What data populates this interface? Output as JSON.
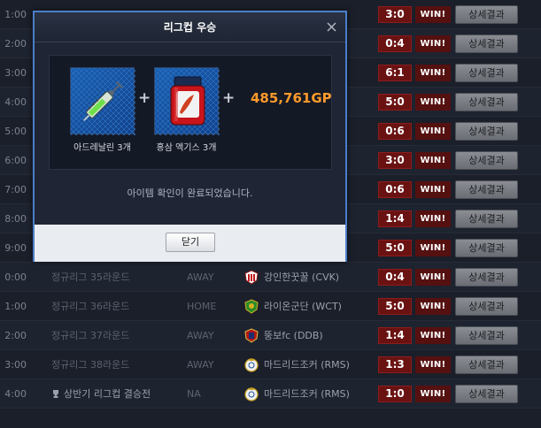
{
  "matches": [
    {
      "time": "1:00",
      "league": "",
      "venue": "",
      "team": "",
      "score": "3:0",
      "result": "WIN!",
      "detail": "상세결과"
    },
    {
      "time": "2:00",
      "league": "",
      "venue": "",
      "team": "",
      "score": "0:4",
      "result": "WIN!",
      "detail": "상세결과"
    },
    {
      "time": "3:00",
      "league": "",
      "venue": "",
      "team": "",
      "score": "6:1",
      "result": "WIN!",
      "detail": "상세결과"
    },
    {
      "time": "4:00",
      "league": "",
      "venue": "",
      "team": "",
      "score": "5:0",
      "result": "WIN!",
      "detail": "상세결과"
    },
    {
      "time": "5:00",
      "league": "",
      "venue": "",
      "team": "",
      "score": "0:6",
      "result": "WIN!",
      "detail": "상세결과"
    },
    {
      "time": "6:00",
      "league": "",
      "venue": "",
      "team": "",
      "score": "3:0",
      "result": "WIN!",
      "detail": "상세결과"
    },
    {
      "time": "7:00",
      "league": "",
      "venue": "",
      "team": "",
      "score": "0:6",
      "result": "WIN!",
      "detail": "상세결과"
    },
    {
      "time": "8:00",
      "league": "",
      "venue": "",
      "team": "",
      "score": "1:4",
      "result": "WIN!",
      "detail": "상세결과"
    },
    {
      "time": "9:00",
      "league": "",
      "venue": "",
      "team": "",
      "score": "5:0",
      "result": "WIN!",
      "detail": "상세결과"
    },
    {
      "time": "0:00",
      "league": "정규리그 35라운드",
      "venue": "AWAY",
      "team": "강인한꿋꿀 (CVK)",
      "score": "0:4",
      "result": "WIN!",
      "detail": "상세결과"
    },
    {
      "time": "1:00",
      "league": "정규리그 36라운드",
      "venue": "HOME",
      "team": "라이온군단 (WCT)",
      "score": "5:0",
      "result": "WIN!",
      "detail": "상세결과"
    },
    {
      "time": "2:00",
      "league": "정규리그 37라운드",
      "venue": "AWAY",
      "team": "뚱보fc (DDB)",
      "score": "1:4",
      "result": "WIN!",
      "detail": "상세결과"
    },
    {
      "time": "3:00",
      "league": "정규리그 38라운드",
      "venue": "AWAY",
      "team": "마드리드조커 (RMS)",
      "score": "1:3",
      "result": "WIN!",
      "detail": "상세결과"
    },
    {
      "time": "4:00",
      "league": "상반기 리그컵 결승전",
      "venue": "NA",
      "team": "마드리드조커 (RMS)",
      "score": "1:0",
      "result": "WIN!",
      "detail": "상세결과"
    }
  ],
  "modal": {
    "title": "리그컵 우승",
    "items": [
      {
        "label": "아드레날린 3개",
        "icon": "syringe-icon"
      },
      {
        "label": "홍삼 액기스 3개",
        "icon": "ginseng-jar-icon"
      }
    ],
    "plus": "+",
    "gp": "485,761GP",
    "message": "아이템 확인이 완료되었습니다.",
    "close_label": "닫기"
  },
  "colors": {
    "score_bg": "#6a1212",
    "gp": "#ff9a2a",
    "modal_border": "#4a7ec9"
  }
}
